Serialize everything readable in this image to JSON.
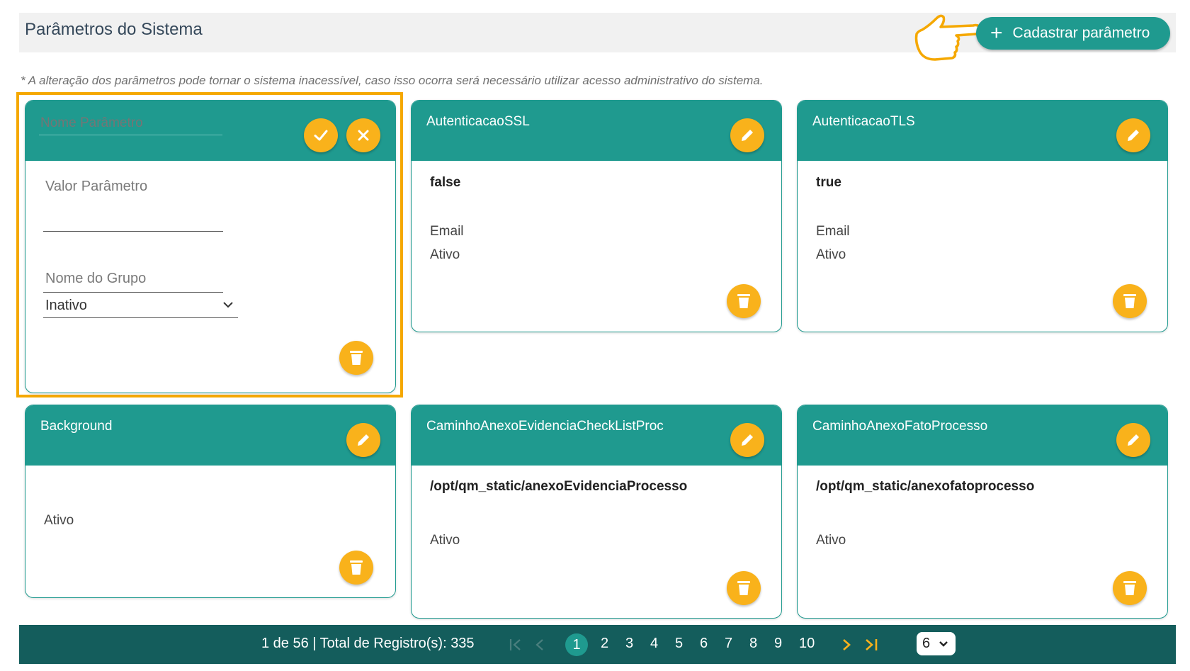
{
  "header": {
    "title": "Parâmetros do Sistema",
    "add_label": "Cadastrar parâmetro"
  },
  "warning": "* A alteração dos parâmetros pode tornar o sistema inacessível, caso isso ocorra será necessário utilizar acesso administrativo do sistema.",
  "new_card": {
    "name_placeholder": "Nome Parâmetro",
    "value_placeholder": "Valor Parâmetro",
    "group_placeholder": "Nome do Grupo",
    "status_selected": "Inativo"
  },
  "cards": [
    {
      "name": "AutenticacaoSSL",
      "value": "false",
      "group": "Email",
      "status": "Ativo"
    },
    {
      "name": "AutenticacaoTLS",
      "value": "true",
      "group": "Email",
      "status": "Ativo"
    },
    {
      "name": "Background",
      "value": "",
      "group": "",
      "status": "Ativo"
    },
    {
      "name": "CaminhoAnexoEvidenciaCheckListProc",
      "value": "/opt/qm_static/anexoEvidenciaProcesso",
      "group": "",
      "status": "Ativo"
    },
    {
      "name": "CaminhoAnexoFatoProcesso",
      "value": "/opt/qm_static/anexofatoprocesso",
      "group": "",
      "status": "Ativo"
    }
  ],
  "pagination": {
    "info": "1 de 56 | Total de Registro(s): 335",
    "first_icon": "first-page-icon",
    "prev_icon": "prev-page-icon",
    "pages": [
      "1",
      "2",
      "3",
      "4",
      "5",
      "6",
      "7",
      "8",
      "9",
      "10"
    ],
    "current": "1",
    "next_icon": "next-page-icon",
    "last_icon": "last-page-icon",
    "per_page": "6"
  },
  "colors": {
    "teal": "#1f9a8f",
    "dark_teal": "#145d5c",
    "accent": "#f9b21b",
    "highlight": "#f5a800"
  }
}
